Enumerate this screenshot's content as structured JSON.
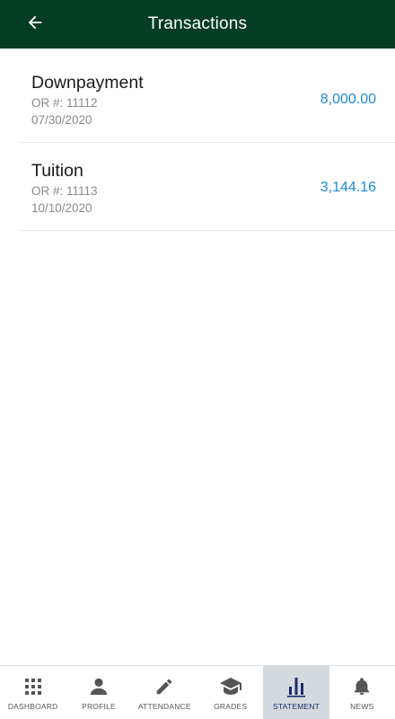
{
  "header": {
    "title": "Transactions",
    "back_icon": "arrow-left-icon"
  },
  "transactions": [
    {
      "name": "Downpayment",
      "or_number": "OR #: 11112",
      "date": "07/30/2020",
      "amount": "8,000.00"
    },
    {
      "name": "Tuition",
      "or_number": "OR #: 11113",
      "date": "10/10/2020",
      "amount": "3,144.16"
    }
  ],
  "bottom_nav": {
    "items": [
      {
        "label": "DASHBOARD",
        "icon": "grid-icon"
      },
      {
        "label": "PROFILE",
        "icon": "person-icon"
      },
      {
        "label": "ATTENDANCE",
        "icon": "pencil-icon"
      },
      {
        "label": "GRADES",
        "icon": "graduation-cap-icon"
      },
      {
        "label": "STATEMENT",
        "icon": "bar-chart-icon",
        "active": true
      },
      {
        "label": "NEWS",
        "icon": "bell-icon"
      }
    ]
  },
  "colors": {
    "header_bg": "#053c24",
    "amount": "#1f8ccf",
    "active_tab_bg": "#d3d9dd",
    "active_icon": "#1c2a6b",
    "inactive_icon": "#555555"
  }
}
